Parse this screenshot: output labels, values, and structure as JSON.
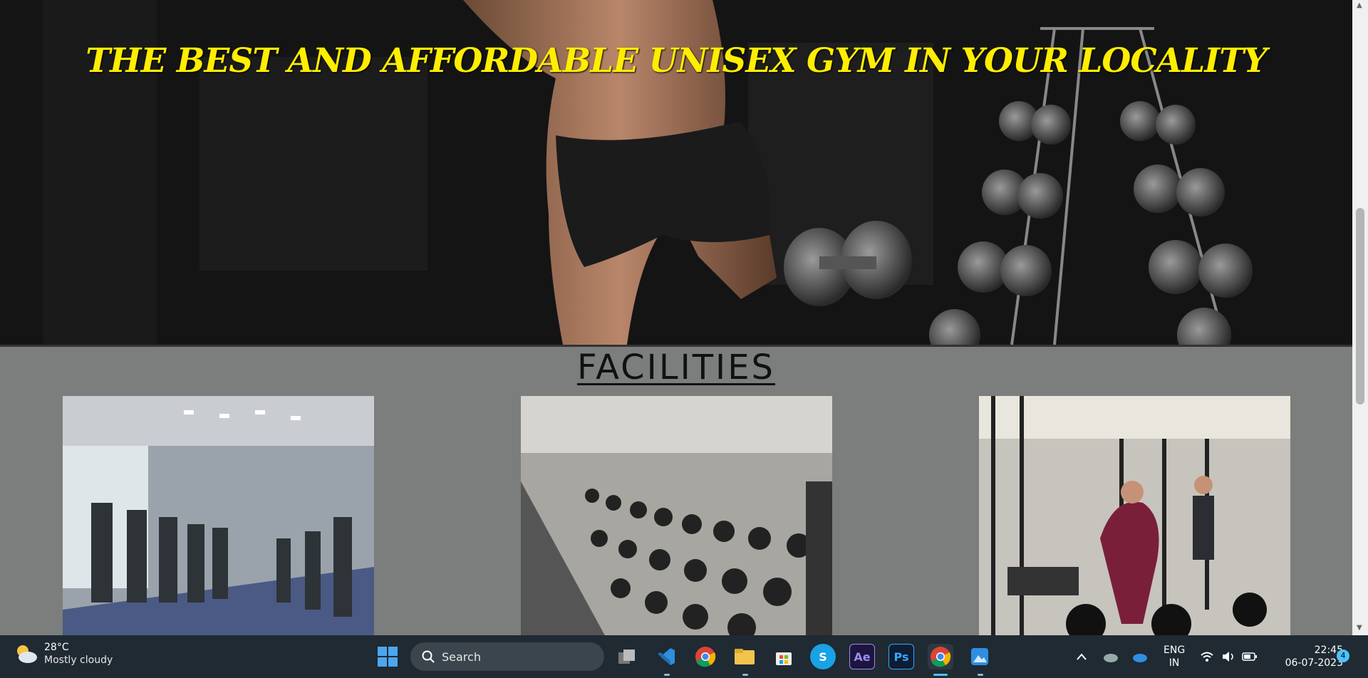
{
  "hero": {
    "title": "THE BEST AND AFFORDABLE UNISEX GYM IN YOUR LOCALITY"
  },
  "facilities": {
    "title": "FACILITIES"
  },
  "taskbar": {
    "weather": {
      "temp": "28°C",
      "condition": "Mostly cloudy"
    },
    "search_label": "Search",
    "apps": [
      "start-icon",
      "task-view-icon",
      "vscode-icon",
      "chrome-icon",
      "file-explorer-icon",
      "store-icon",
      "skype-icon",
      "after-effects-icon",
      "photoshop-icon",
      "chrome-active-icon",
      "photos-icon"
    ],
    "app_labels": {
      "skype": "S",
      "after_effects": "Ae",
      "photoshop": "Ps"
    },
    "language": {
      "line1": "ENG",
      "line2": "IN"
    },
    "clock": {
      "time": "22:45",
      "date": "06-07-2023"
    },
    "notification_count": "4"
  },
  "colors": {
    "hero_title": "#ffee00",
    "taskbar_bg": "#1f2a33",
    "page_bg": "#7b7e7c"
  }
}
